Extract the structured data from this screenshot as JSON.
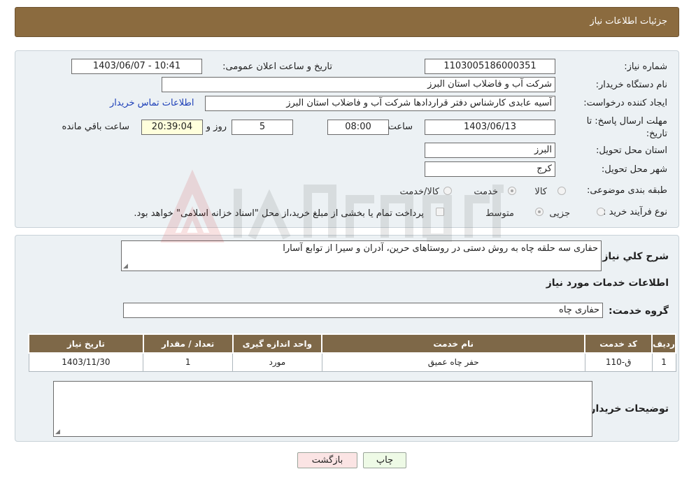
{
  "header": {
    "title": "جزئیات اطلاعات نیاز"
  },
  "form": {
    "need_number_label": "شماره نیاز:",
    "need_number": "1103005186000351",
    "announce_label": "تاریخ و ساعت اعلان عمومی:",
    "announce_value": "1403/06/07 - 10:41",
    "buyer_org_label": "نام دستگاه خریدار:",
    "buyer_org": "شرکت آب و فاضلاب استان البرز",
    "creator_label": "ایجاد کننده درخواست:",
    "creator": "آسیه عابدی کارشناس دفتر قراردادها شرکت آب و فاضلاب استان البرز",
    "contact_link": "اطلاعات تماس خریدار",
    "deadline_label": "مهلت ارسال پاسخ: تا تاریخ:",
    "deadline_date": "1403/06/13",
    "time_label": "ساعت",
    "deadline_time": "08:00",
    "days_value": "5",
    "days_label": "روز و",
    "remaining_time": "20:39:04",
    "remaining_label": "ساعت باقي مانده",
    "province_label": "استان محل تحویل:",
    "province": "البرز",
    "city_label": "شهر محل تحویل:",
    "city": "کرج",
    "category_label": "طبقه بندی موضوعی:",
    "category_options": [
      "کالا",
      "خدمت",
      "کالا/خدمت"
    ],
    "purchase_label": "نوع فرآیند خرید :",
    "purchase_options": [
      "جزیی",
      "متوسط"
    ],
    "payment_note": "پرداخت تمام یا بخشی از مبلغ خرید،از محل \"اسناد خزانه اسلامی\" خواهد بود."
  },
  "details": {
    "summary_label": "شرح کلي نياز:",
    "summary": "حفاری سه حلقه چاه به روش دستی در روستاهای حرین، آدران و سیرا از توابع آسارا",
    "services_heading": "اطلاعات خدمات مورد نیاز",
    "service_group_label": "گروه خدمت:",
    "service_group": "حفاری چاه",
    "buyer_notes_label": "توضیحات خریدار:",
    "buyer_notes": ""
  },
  "table": {
    "headers": [
      "ردیف",
      "کد خدمت",
      "نام خدمت",
      "واحد اندازه گیری",
      "تعداد / مقدار",
      "تاریخ نیاز"
    ],
    "rows": [
      [
        "1",
        "ق-110",
        "حفر چاه عمیق",
        "مورد",
        "1",
        "1403/11/30"
      ]
    ]
  },
  "buttons": {
    "print": "چاپ",
    "back": "بازگشت"
  },
  "colors": {
    "header_bg": "#8b6b3f",
    "table_header_bg": "#7e6848",
    "panel_bg": "#ecf1f4",
    "link": "#1d3fb8"
  }
}
